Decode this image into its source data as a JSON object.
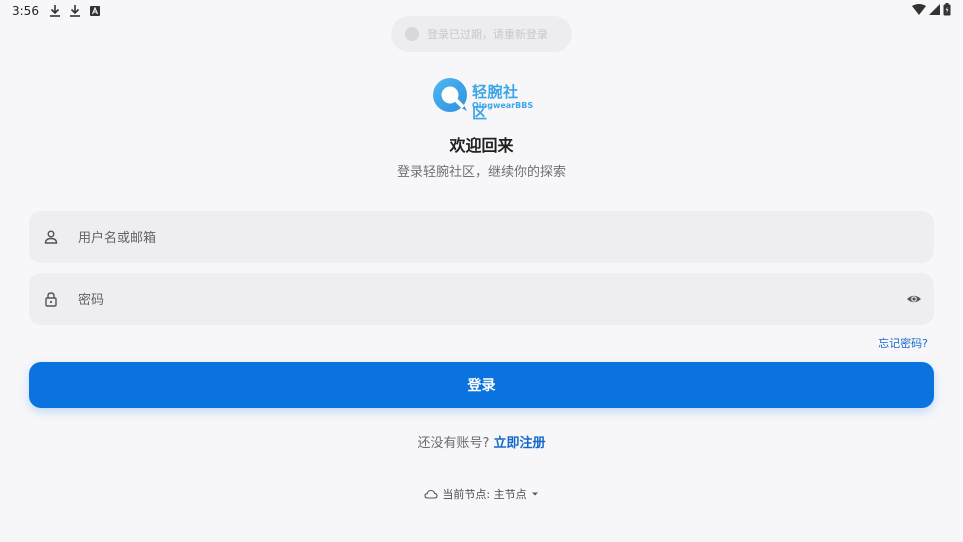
{
  "status_bar": {
    "time": "3:56",
    "left_icons": [
      "download-icon",
      "download-icon",
      "app-a-icon"
    ],
    "right_icons": [
      "wifi-icon",
      "signal-icon",
      "battery-icon"
    ]
  },
  "toast": {
    "text": "登录已过期，请重新登录"
  },
  "logo": {
    "main": "轻腕社区",
    "sub": "QingwearBBS"
  },
  "header": {
    "title": "欢迎回来",
    "subtitle": "登录轻腕社区，继续你的探索"
  },
  "form": {
    "username_placeholder": "用户名或邮箱",
    "username_value": "",
    "password_placeholder": "密码",
    "password_value": "",
    "forgot_label": "忘记密码?",
    "login_label": "登录"
  },
  "register": {
    "prompt": "还没有账号?",
    "link_label": "立即注册"
  },
  "node": {
    "label": "当前节点: 主节点"
  },
  "colors": {
    "accent": "#0a73e0",
    "link": "#1769c9",
    "background": "#f7f7f9",
    "field_bg": "#eeeef2",
    "logo": "#3aa6e8"
  }
}
